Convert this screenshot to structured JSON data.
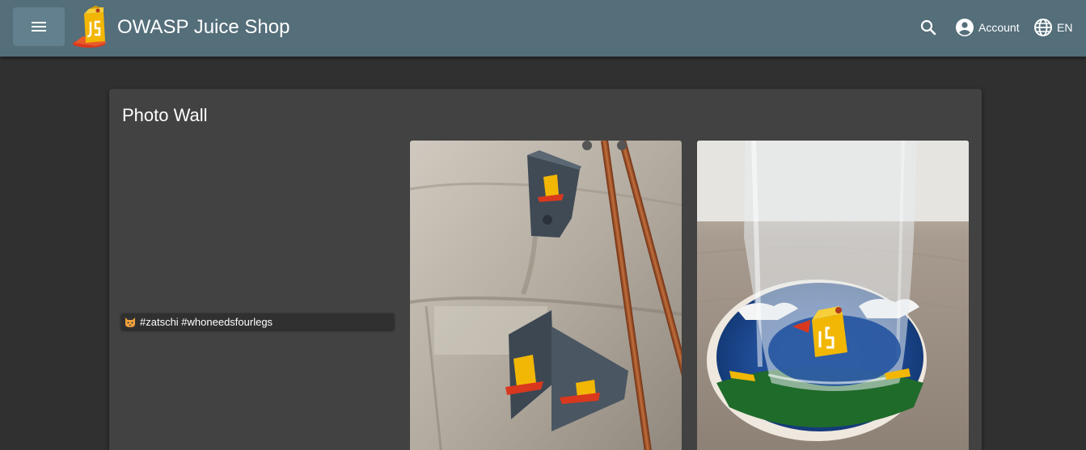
{
  "header": {
    "app_title": "OWASP Juice Shop",
    "account_label": "Account",
    "language_label": "EN"
  },
  "page": {
    "title": "Photo Wall"
  },
  "memories": [
    {
      "caption": "#zatschi #whoneedsfourlegs",
      "emoji": "cat-face"
    },
    {
      "caption": "",
      "image": "juice-shop-stickers-on-metal-brackets"
    },
    {
      "caption": "",
      "image": "juice-shop-coaster-under-glass"
    }
  ],
  "colors": {
    "toolbar": "#546e7a",
    "menu_button": "#62808d",
    "background": "#303030",
    "card": "#424242"
  },
  "icons": [
    "menu-icon",
    "search-icon",
    "account-circle-icon",
    "language-globe-icon"
  ]
}
